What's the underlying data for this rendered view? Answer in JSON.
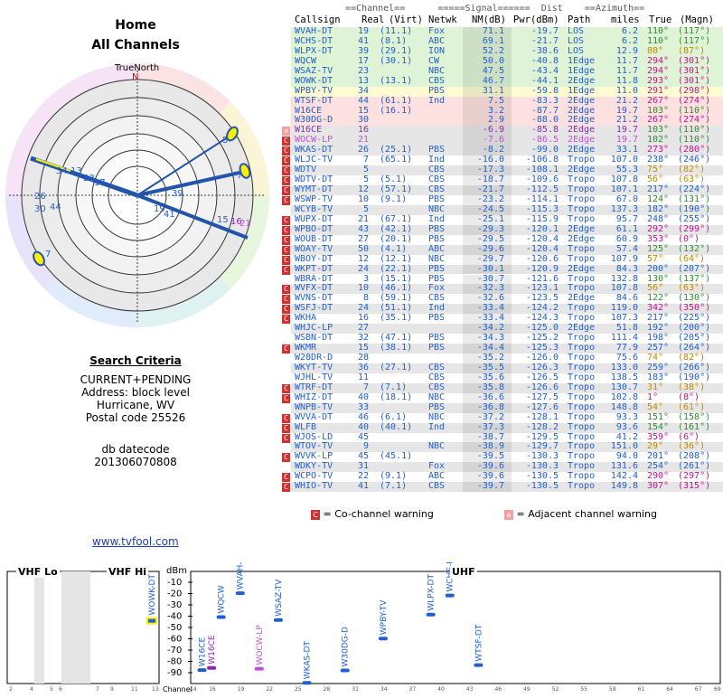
{
  "header": {
    "title": "Home",
    "subtitle": "All Channels"
  },
  "polar": {
    "north_label": "TrueNorth",
    "n_marker": "N"
  },
  "criteria": {
    "heading": "Search Criteria",
    "mode": "CURRENT+PENDING",
    "address": "Address: block level",
    "city": "Hurricane, WV",
    "postal": "Postal code 25526",
    "db_label": "db datecode",
    "db_code": "201306070808"
  },
  "link": {
    "text": "www.tvfool.com"
  },
  "table_headers": {
    "line1": "==Channel==      =====Signal======  Dist    ==Azimuth==",
    "callsign": "Callsign",
    "real": "Real",
    "virt": "(Virt)",
    "netwk": "Netwk",
    "nm": "NM(dB)",
    "pwr": "Pwr(dBm)",
    "path": "Path",
    "miles": "miles",
    "true": "True",
    "magn": "(Magn)"
  },
  "rows": [
    {
      "cs": "WVAH-DT",
      "real": "19",
      "virt": "(11.1)",
      "net": "Fox",
      "nm": "71.1",
      "pwr": "-19.7",
      "path": "LOS",
      "dist": "6.2",
      "az": "110°",
      "mag": "(117°)",
      "color": "#1f5fcf",
      "bg": "#dff3d6",
      "warn": ""
    },
    {
      "cs": "WCHS-DT",
      "real": "41",
      "virt": "(8.1)",
      "net": "ABC",
      "nm": "69.1",
      "pwr": "-21.7",
      "path": "LOS",
      "dist": "6.2",
      "az": "110°",
      "mag": "(117°)",
      "color": "#1f5fcf",
      "bg": "#dff3d6",
      "warn": ""
    },
    {
      "cs": "WLPX-DT",
      "real": "39",
      "virt": "(29.1)",
      "net": "ION",
      "nm": "52.2",
      "pwr": "-38.6",
      "path": "LOS",
      "dist": "12.9",
      "az": "80°",
      "mag": "(87°)",
      "color": "#1f5fcf",
      "bg": "#dff3d6",
      "warn": ""
    },
    {
      "cs": "WQCW",
      "real": "17",
      "virt": "(30.1)",
      "net": "CW",
      "nm": "50.0",
      "pwr": "-40.8",
      "path": "1Edge",
      "dist": "11.7",
      "az": "294°",
      "mag": "(301°)",
      "color": "#1f5fcf",
      "bg": "#dff3d6",
      "warn": ""
    },
    {
      "cs": "WSAZ-TV",
      "real": "23",
      "virt": "",
      "net": "NBC",
      "nm": "47.5",
      "pwr": "-43.4",
      "path": "1Edge",
      "dist": "11.7",
      "az": "294°",
      "mag": "(301°)",
      "color": "#1f5fcf",
      "bg": "#dff3d6",
      "warn": ""
    },
    {
      "cs": "WOWK-DT",
      "real": "13",
      "virt": "(13.1)",
      "net": "CBS",
      "nm": "46.7",
      "pwr": "-44.1",
      "path": "2Edge",
      "dist": "11.8",
      "az": "293°",
      "mag": "(301°)",
      "color": "#1f5fcf",
      "bg": "#dff3d6",
      "warn": ""
    },
    {
      "cs": "WPBY-TV",
      "real": "34",
      "virt": "",
      "net": "PBS",
      "nm": "31.1",
      "pwr": "-59.8",
      "path": "1Edge",
      "dist": "11.0",
      "az": "291°",
      "mag": "(298°)",
      "color": "#1f5fcf",
      "bg": "#fdfbd2",
      "warn": ""
    },
    {
      "cs": "WTSF-DT",
      "real": "44",
      "virt": "(61.1)",
      "net": "Ind",
      "nm": "7.5",
      "pwr": "-83.3",
      "path": "2Edge",
      "dist": "21.2",
      "az": "267°",
      "mag": "(274°)",
      "color": "#1f5fcf",
      "bg": "#fde0e0",
      "warn": ""
    },
    {
      "cs": "W16CE",
      "real": "15",
      "virt": "(16.1)",
      "net": "",
      "nm": "3.2",
      "pwr": "-87.7",
      "path": "2Edge",
      "dist": "19.7",
      "az": "103°",
      "mag": "(110°)",
      "color": "#1f5fcf",
      "bg": "#fde0e0",
      "warn": ""
    },
    {
      "cs": "W30DG-D",
      "real": "30",
      "virt": "",
      "net": "",
      "nm": "2.9",
      "pwr": "-88.0",
      "path": "2Edge",
      "dist": "21.2",
      "az": "267°",
      "mag": "(274°)",
      "color": "#1f5fcf",
      "bg": "#fde0e0",
      "warn": ""
    },
    {
      "cs": "W16CE",
      "real": "16",
      "virt": "",
      "net": "",
      "nm": "-6.9",
      "pwr": "-85.8",
      "path": "2Edge",
      "dist": "19.7",
      "az": "103°",
      "mag": "(110°)",
      "color": "#8a2ab0",
      "bg": "#e6e6e6",
      "warn": "a"
    },
    {
      "cs": "WOCW-LP",
      "real": "21",
      "virt": "",
      "net": "",
      "nm": "-7.6",
      "pwr": "-86.5",
      "path": "2Edge",
      "dist": "19.7",
      "az": "102°",
      "mag": "(110°)",
      "color": "#c050d8",
      "bg": "#e6e6e6",
      "warn": "c"
    },
    {
      "cs": "WKAS-DT",
      "real": "26",
      "virt": "(25.1)",
      "net": "PBS",
      "nm": "-8.2",
      "pwr": "-99.0",
      "path": "2Edge",
      "dist": "33.1",
      "az": "273°",
      "mag": "(280°)",
      "color": "#1f5fcf",
      "bg": "#e6e6e6",
      "warn": "c"
    },
    {
      "cs": "WLJC-TV",
      "real": "7",
      "virt": "(65.1)",
      "net": "Ind",
      "nm": "-16.0",
      "pwr": "-106.8",
      "path": "Tropo",
      "dist": "107.0",
      "az": "238°",
      "mag": "(246°)",
      "color": "#1f5fcf",
      "bg": "#fff",
      "warn": "c"
    },
    {
      "cs": "WDTV",
      "real": "5",
      "virt": "",
      "net": "CBS",
      "nm": "-17.3",
      "pwr": "-108.1",
      "path": "2Edge",
      "dist": "55.3",
      "az": "75°",
      "mag": "(82°)",
      "color": "#1f5fcf",
      "bg": "#e6e6e6",
      "warn": "c"
    },
    {
      "cs": "WDTV-DT",
      "real": "5",
      "virt": "(5.1)",
      "net": "CBS",
      "nm": "-18.7",
      "pwr": "-109.6",
      "path": "Tropo",
      "dist": "107.8",
      "az": "56°",
      "mag": "(63°)",
      "color": "#1f5fcf",
      "bg": "#fff",
      "warn": "c"
    },
    {
      "cs": "WYMT-DT",
      "real": "12",
      "virt": "(57.1)",
      "net": "CBS",
      "nm": "-21.7",
      "pwr": "-112.5",
      "path": "Tropo",
      "dist": "107.1",
      "az": "217°",
      "mag": "(224°)",
      "color": "#1f5fcf",
      "bg": "#e6e6e6",
      "warn": "c"
    },
    {
      "cs": "WSWP-TV",
      "real": "10",
      "virt": "(9.1)",
      "net": "PBS",
      "nm": "-23.2",
      "pwr": "-114.1",
      "path": "Tropo",
      "dist": "67.0",
      "az": "124°",
      "mag": "(131°)",
      "color": "#1f5fcf",
      "bg": "#fff",
      "warn": "c"
    },
    {
      "cs": "WCYB-TV",
      "real": "5",
      "virt": "",
      "net": "NBC",
      "nm": "-24.5",
      "pwr": "-115.3",
      "path": "Tropo",
      "dist": "137.3",
      "az": "182°",
      "mag": "(190°)",
      "color": "#1f5fcf",
      "bg": "#e6e6e6",
      "warn": ""
    },
    {
      "cs": "WUPX-DT",
      "real": "21",
      "virt": "(67.1)",
      "net": "Ind",
      "nm": "-25.1",
      "pwr": "-115.9",
      "path": "Tropo",
      "dist": "95.7",
      "az": "248°",
      "mag": "(255°)",
      "color": "#1f5fcf",
      "bg": "#fff",
      "warn": "c"
    },
    {
      "cs": "WPBO-DT",
      "real": "43",
      "virt": "(42.1)",
      "net": "PBS",
      "nm": "-29.3",
      "pwr": "-120.1",
      "path": "2Edge",
      "dist": "61.1",
      "az": "292°",
      "mag": "(299°)",
      "color": "#1f5fcf",
      "bg": "#e6e6e6",
      "warn": "c"
    },
    {
      "cs": "WOUB-DT",
      "real": "27",
      "virt": "(20.1)",
      "net": "PBS",
      "nm": "-29.5",
      "pwr": "-120.4",
      "path": "2Edge",
      "dist": "60.9",
      "az": "353°",
      "mag": "(0°)",
      "color": "#1f5fcf",
      "bg": "#fff",
      "warn": "c"
    },
    {
      "cs": "WOAY-TV",
      "real": "50",
      "virt": "(4.1)",
      "net": "ABC",
      "nm": "-29.6",
      "pwr": "-120.4",
      "path": "Tropo",
      "dist": "57.4",
      "az": "125°",
      "mag": "(132°)",
      "color": "#1f5fcf",
      "bg": "#e6e6e6",
      "warn": "c"
    },
    {
      "cs": "WBOY-DT",
      "real": "12",
      "virt": "(12.1)",
      "net": "NBC",
      "nm": "-29.7",
      "pwr": "-120.6",
      "path": "Tropo",
      "dist": "107.9",
      "az": "57°",
      "mag": "(64°)",
      "color": "#1f5fcf",
      "bg": "#fff",
      "warn": "c"
    },
    {
      "cs": "WKPT-DT",
      "real": "24",
      "virt": "(22.1)",
      "net": "PBS",
      "nm": "-30.1",
      "pwr": "-120.9",
      "path": "2Edge",
      "dist": "84.3",
      "az": "200°",
      "mag": "(207°)",
      "color": "#1f5fcf",
      "bg": "#e6e6e6",
      "warn": "c"
    },
    {
      "cs": "WBRA-DT",
      "real": "3",
      "virt": "(15.1)",
      "net": "PBS",
      "nm": "-30.7",
      "pwr": "-121.6",
      "path": "Tropo",
      "dist": "132.8",
      "az": "130°",
      "mag": "(137°)",
      "color": "#1f5fcf",
      "bg": "#fff",
      "warn": ""
    },
    {
      "cs": "WVFX-DT",
      "real": "10",
      "virt": "(46.1)",
      "net": "Fox",
      "nm": "-32.3",
      "pwr": "-123.1",
      "path": "Tropo",
      "dist": "107.8",
      "az": "56°",
      "mag": "(63°)",
      "color": "#1f5fcf",
      "bg": "#e6e6e6",
      "warn": "c"
    },
    {
      "cs": "WVNS-DT",
      "real": "8",
      "virt": "(59.1)",
      "net": "CBS",
      "nm": "-32.6",
      "pwr": "-123.5",
      "path": "2Edge",
      "dist": "84.6",
      "az": "122°",
      "mag": "(130°)",
      "color": "#1f5fcf",
      "bg": "#fff",
      "warn": "c"
    },
    {
      "cs": "WSFJ-DT",
      "real": "24",
      "virt": "(51.1)",
      "net": "Ind",
      "nm": "-33.4",
      "pwr": "-124.2",
      "path": "Tropo",
      "dist": "119.0",
      "az": "342°",
      "mag": "(350°)",
      "color": "#1f5fcf",
      "bg": "#e6e6e6",
      "warn": "c"
    },
    {
      "cs": "WKHA",
      "real": "16",
      "virt": "(35.1)",
      "net": "PBS",
      "nm": "-33.4",
      "pwr": "-124.3",
      "path": "Tropo",
      "dist": "107.3",
      "az": "217°",
      "mag": "(225°)",
      "color": "#1f5fcf",
      "bg": "#fff",
      "warn": "c"
    },
    {
      "cs": "WHJC-LP",
      "real": "27",
      "virt": "",
      "net": "",
      "nm": "-34.2",
      "pwr": "-125.0",
      "path": "2Edge",
      "dist": "51.8",
      "az": "192°",
      "mag": "(200°)",
      "color": "#1f5fcf",
      "bg": "#e6e6e6",
      "warn": ""
    },
    {
      "cs": "WSBN-DT",
      "real": "32",
      "virt": "(47.1)",
      "net": "PBS",
      "nm": "-34.3",
      "pwr": "-125.2",
      "path": "Tropo",
      "dist": "111.4",
      "az": "198°",
      "mag": "(205°)",
      "color": "#1f5fcf",
      "bg": "#fff",
      "warn": ""
    },
    {
      "cs": "WKMR",
      "real": "15",
      "virt": "(38.1)",
      "net": "PBS",
      "nm": "-34.4",
      "pwr": "-125.3",
      "path": "Tropo",
      "dist": "77.9",
      "az": "257°",
      "mag": "(264°)",
      "color": "#1f5fcf",
      "bg": "#e6e6e6",
      "warn": "c"
    },
    {
      "cs": "W28DR-D",
      "real": "28",
      "virt": "",
      "net": "",
      "nm": "-35.2",
      "pwr": "-126.0",
      "path": "Tropo",
      "dist": "75.6",
      "az": "74°",
      "mag": "(82°)",
      "color": "#1f5fcf",
      "bg": "#fff",
      "warn": ""
    },
    {
      "cs": "WKYT-TV",
      "real": "36",
      "virt": "(27.1)",
      "net": "CBS",
      "nm": "-35.5",
      "pwr": "-126.3",
      "path": "Tropo",
      "dist": "133.0",
      "az": "259°",
      "mag": "(266°)",
      "color": "#1f5fcf",
      "bg": "#e6e6e6",
      "warn": ""
    },
    {
      "cs": "WJHL-TV",
      "real": "11",
      "virt": "",
      "net": "CBS",
      "nm": "-35.6",
      "pwr": "-126.5",
      "path": "Tropo",
      "dist": "138.5",
      "az": "183°",
      "mag": "(190°)",
      "color": "#1f5fcf",
      "bg": "#fff",
      "warn": ""
    },
    {
      "cs": "WTRF-DT",
      "real": "7",
      "virt": "(7.1)",
      "net": "CBS",
      "nm": "-35.8",
      "pwr": "-126.6",
      "path": "Tropo",
      "dist": "130.7",
      "az": "31°",
      "mag": "(38°)",
      "color": "#1f5fcf",
      "bg": "#e6e6e6",
      "warn": "c"
    },
    {
      "cs": "WHIZ-DT",
      "real": "40",
      "virt": "(18.1)",
      "net": "NBC",
      "nm": "-36.6",
      "pwr": "-127.5",
      "path": "Tropo",
      "dist": "102.8",
      "az": "1°",
      "mag": "(8°)",
      "color": "#1f5fcf",
      "bg": "#fff",
      "warn": "c"
    },
    {
      "cs": "WNPB-TV",
      "real": "33",
      "virt": "",
      "net": "PBS",
      "nm": "-36.8",
      "pwr": "-127.6",
      "path": "Tropo",
      "dist": "148.8",
      "az": "54°",
      "mag": "(61°)",
      "color": "#1f5fcf",
      "bg": "#e6e6e6",
      "warn": ""
    },
    {
      "cs": "WVVA-DT",
      "real": "46",
      "virt": "(6.1)",
      "net": "NBC",
      "nm": "-37.2",
      "pwr": "-128.1",
      "path": "Tropo",
      "dist": "93.3",
      "az": "151°",
      "mag": "(158°)",
      "color": "#1f5fcf",
      "bg": "#fff",
      "warn": "c"
    },
    {
      "cs": "WLFB",
      "real": "40",
      "virt": "(40.1)",
      "net": "Ind",
      "nm": "-37.3",
      "pwr": "-128.2",
      "path": "Tropo",
      "dist": "93.6",
      "az": "154°",
      "mag": "(161°)",
      "color": "#1f5fcf",
      "bg": "#e6e6e6",
      "warn": "c"
    },
    {
      "cs": "WJOS-LD",
      "real": "45",
      "virt": "",
      "net": "",
      "nm": "-38.7",
      "pwr": "-129.5",
      "path": "Tropo",
      "dist": "41.2",
      "az": "359°",
      "mag": "(6°)",
      "color": "#1f5fcf",
      "bg": "#fff",
      "warn": "c"
    },
    {
      "cs": "WTOV-TV",
      "real": "9",
      "virt": "",
      "net": "NBC",
      "nm": "-38.9",
      "pwr": "-129.7",
      "path": "Tropo",
      "dist": "151.0",
      "az": "29°",
      "mag": "(36°)",
      "color": "#1f5fcf",
      "bg": "#e6e6e6",
      "warn": ""
    },
    {
      "cs": "WVVK-LP",
      "real": "45",
      "virt": "(45.1)",
      "net": "",
      "nm": "-39.5",
      "pwr": "-130.3",
      "path": "Tropo",
      "dist": "94.0",
      "az": "201°",
      "mag": "(208°)",
      "color": "#1f5fcf",
      "bg": "#fff",
      "warn": "c"
    },
    {
      "cs": "WDKY-TV",
      "real": "31",
      "virt": "",
      "net": "Fox",
      "nm": "-39.6",
      "pwr": "-130.3",
      "path": "Tropo",
      "dist": "131.6",
      "az": "254°",
      "mag": "(261°)",
      "color": "#1f5fcf",
      "bg": "#e6e6e6",
      "warn": ""
    },
    {
      "cs": "WCPO-TV",
      "real": "22",
      "virt": "(9.1)",
      "net": "ABC",
      "nm": "-39.6",
      "pwr": "-130.5",
      "path": "Tropo",
      "dist": "142.4",
      "az": "290°",
      "mag": "(297°)",
      "color": "#1f5fcf",
      "bg": "#fff",
      "warn": "c"
    },
    {
      "cs": "WHIO-TV",
      "real": "41",
      "virt": "(7.1)",
      "net": "CBS",
      "nm": "-39.7",
      "pwr": "-130.5",
      "path": "Tropo",
      "dist": "149.8",
      "az": "307°",
      "mag": "(315°)",
      "color": "#1f5fcf",
      "bg": "#e6e6e6",
      "warn": "c"
    }
  ],
  "legend": {
    "c_mark": "C",
    "c_text": "= Co-channel warning",
    "a_mark": "a",
    "a_text": "= Adjacent channel warning"
  },
  "spectrum": {
    "vhf_lo": "VHF Lo",
    "vhf_hi": "VHF Hi",
    "uhf": "UHF",
    "dbm": "dBm",
    "channel_label": "Channel",
    "db_ticks": [
      "-10",
      "-20",
      "-30",
      "-40",
      "-50",
      "-60",
      "-70",
      "-80",
      "-90"
    ],
    "vhf_ticks": [
      "2",
      "4",
      "5",
      "6",
      "7",
      "9",
      "11",
      "13"
    ],
    "uhf_ticks": [
      "14",
      "16",
      "19",
      "22",
      "25",
      "28",
      "31",
      "34",
      "37",
      "40",
      "43",
      "46",
      "49",
      "52",
      "55",
      "58",
      "61",
      "64",
      "67",
      "69"
    ],
    "vhf_stations": [
      {
        "label": "WOWK-DT",
        "ch": 13,
        "dbm": -44.1,
        "color": "#1f5fcf"
      }
    ],
    "uhf_stations": [
      {
        "label": "W16CE",
        "ch": 15,
        "dbm": -87.7,
        "color": "#1f5fcf"
      },
      {
        "label": "W16CE",
        "ch": 16,
        "dbm": -85.8,
        "color": "#8a2ab0"
      },
      {
        "label": "WQCW",
        "ch": 17,
        "dbm": -40.8,
        "color": "#1f5fcf"
      },
      {
        "label": "WVAH-DT",
        "ch": 19,
        "dbm": -19.7,
        "color": "#1f5fcf"
      },
      {
        "label": "WOCW-LP",
        "ch": 21,
        "dbm": -86.5,
        "color": "#c050d8"
      },
      {
        "label": "WSAZ-TV",
        "ch": 23,
        "dbm": -43.4,
        "color": "#1f5fcf"
      },
      {
        "label": "WKAS-DT",
        "ch": 26,
        "dbm": -99.0,
        "color": "#1f5fcf"
      },
      {
        "label": "W30DG-D",
        "ch": 30,
        "dbm": -88.0,
        "color": "#1f5fcf"
      },
      {
        "label": "WPBY-TV",
        "ch": 34,
        "dbm": -59.8,
        "color": "#1f5fcf"
      },
      {
        "label": "WLPX-DT",
        "ch": 39,
        "dbm": -38.6,
        "color": "#1f5fcf"
      },
      {
        "label": "WCHS-DT",
        "ch": 41,
        "dbm": -21.7,
        "color": "#1f5fcf"
      },
      {
        "label": "WTSF-DT",
        "ch": 44,
        "dbm": -83.3,
        "color": "#1f5fcf"
      }
    ]
  },
  "polar_labels": [
    {
      "t": "5",
      "c": "#1f5fcf"
    },
    {
      "t": "7",
      "c": "#1f5fcf"
    },
    {
      "t": "34",
      "c": "#1f5fcf"
    },
    {
      "t": "13",
      "c": "#1f5fcf"
    },
    {
      "t": "23",
      "c": "#1f5fcf"
    },
    {
      "t": "17",
      "c": "#1f5fcf"
    },
    {
      "t": "26",
      "c": "#1f5fcf"
    },
    {
      "t": "30",
      "c": "#1f5fcf"
    },
    {
      "t": "44",
      "c": "#1f5fcf"
    },
    {
      "t": "39",
      "c": "#1f5fcf"
    },
    {
      "t": "19",
      "c": "#1f5fcf"
    },
    {
      "t": "41",
      "c": "#1f5fcf"
    },
    {
      "t": "15",
      "c": "#1f5fcf"
    },
    {
      "t": "16",
      "c": "#8a2ab0"
    },
    {
      "t": "21",
      "c": "#c050d8"
    },
    {
      "t": "7",
      "c": "#1f5fcf"
    }
  ]
}
